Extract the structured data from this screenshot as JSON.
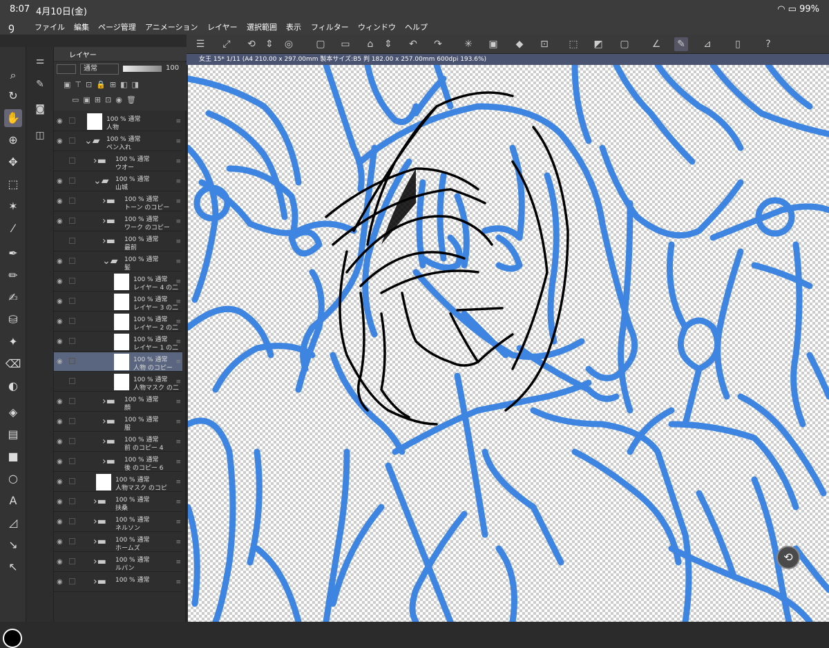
{
  "status": {
    "time": "8:07",
    "date": "4月10日(金)",
    "battery": "99%"
  },
  "menu": [
    "ファイル",
    "編集",
    "ページ管理",
    "アニメーション",
    "レイヤー",
    "選択範囲",
    "表示",
    "フィルター",
    "ウィンドウ",
    "ヘルプ"
  ],
  "doc_tab": "女王 15* 1/11 (A4 210.00 x 297.00mm 製本サイズ:B5 判 182.00 x 257.00mm 600dpi 193.6%)",
  "layer_panel": {
    "title": "レイヤー",
    "blend": "通常",
    "opacity": "100"
  },
  "layers": [
    {
      "l1": "100 % 通常",
      "l2": "人物",
      "indent": 0,
      "kind": "layer",
      "eye": true
    },
    {
      "l1": "100 % 通常",
      "l2": "ペン入れ",
      "indent": 0,
      "kind": "folder-open",
      "eye": true
    },
    {
      "l1": "100 % 通常",
      "l2": "ウオー",
      "indent": 1,
      "kind": "folder",
      "eye": false
    },
    {
      "l1": "100 % 通常",
      "l2": "山城",
      "indent": 1,
      "kind": "folder-open",
      "eye": true
    },
    {
      "l1": "100 % 通常",
      "l2": "トーン のコピー",
      "indent": 2,
      "kind": "folder",
      "eye": true
    },
    {
      "l1": "100 % 通常",
      "l2": "ワーク のコピー",
      "indent": 2,
      "kind": "folder",
      "eye": true
    },
    {
      "l1": "100 % 通常",
      "l2": "最前",
      "indent": 2,
      "kind": "folder",
      "eye": false
    },
    {
      "l1": "100 % 通常",
      "l2": "髪",
      "indent": 2,
      "kind": "folder-open",
      "eye": true
    },
    {
      "l1": "100 % 通常",
      "l2": "レイヤー 4 の二",
      "indent": 3,
      "kind": "layer",
      "eye": true
    },
    {
      "l1": "100 % 通常",
      "l2": "レイヤー 3 の二",
      "indent": 3,
      "kind": "layer",
      "eye": true
    },
    {
      "l1": "100 % 通常",
      "l2": "レイヤー 2 の二",
      "indent": 3,
      "kind": "layer",
      "eye": true
    },
    {
      "l1": "100 % 通常",
      "l2": "レイヤー 1 の二",
      "indent": 3,
      "kind": "layer",
      "eye": true
    },
    {
      "l1": "100 % 通常",
      "l2": "人物 のコピー",
      "indent": 3,
      "kind": "layer",
      "eye": true,
      "selected": true
    },
    {
      "l1": "100 % 通常",
      "l2": "人物マスク の二",
      "indent": 3,
      "kind": "layer",
      "eye": false
    },
    {
      "l1": "100 % 通常",
      "l2": "顔",
      "indent": 2,
      "kind": "folder",
      "eye": true
    },
    {
      "l1": "100 % 通常",
      "l2": "服",
      "indent": 2,
      "kind": "folder",
      "eye": true
    },
    {
      "l1": "100 % 通常",
      "l2": "前 のコピー 4",
      "indent": 2,
      "kind": "folder",
      "eye": true
    },
    {
      "l1": "100 % 通常",
      "l2": "後 のコピー 6",
      "indent": 2,
      "kind": "folder",
      "eye": true
    },
    {
      "l1": "100 % 通常",
      "l2": "人物マスク のコピ",
      "indent": 1,
      "kind": "layer",
      "eye": true
    },
    {
      "l1": "100 % 通常",
      "l2": "扶桑",
      "indent": 1,
      "kind": "folder",
      "eye": true
    },
    {
      "l1": "100 % 通常",
      "l2": "ネルソン",
      "indent": 1,
      "kind": "folder",
      "eye": true
    },
    {
      "l1": "100 % 通常",
      "l2": "ホームズ",
      "indent": 1,
      "kind": "folder",
      "eye": true
    },
    {
      "l1": "100 % 通常",
      "l2": "ルパン",
      "indent": 1,
      "kind": "folder",
      "eye": true
    },
    {
      "l1": "100 % 通常",
      "l2": "",
      "indent": 1,
      "kind": "folder",
      "eye": true
    }
  ],
  "colors": {
    "accent": "#3d85e0",
    "line": "#000000"
  }
}
